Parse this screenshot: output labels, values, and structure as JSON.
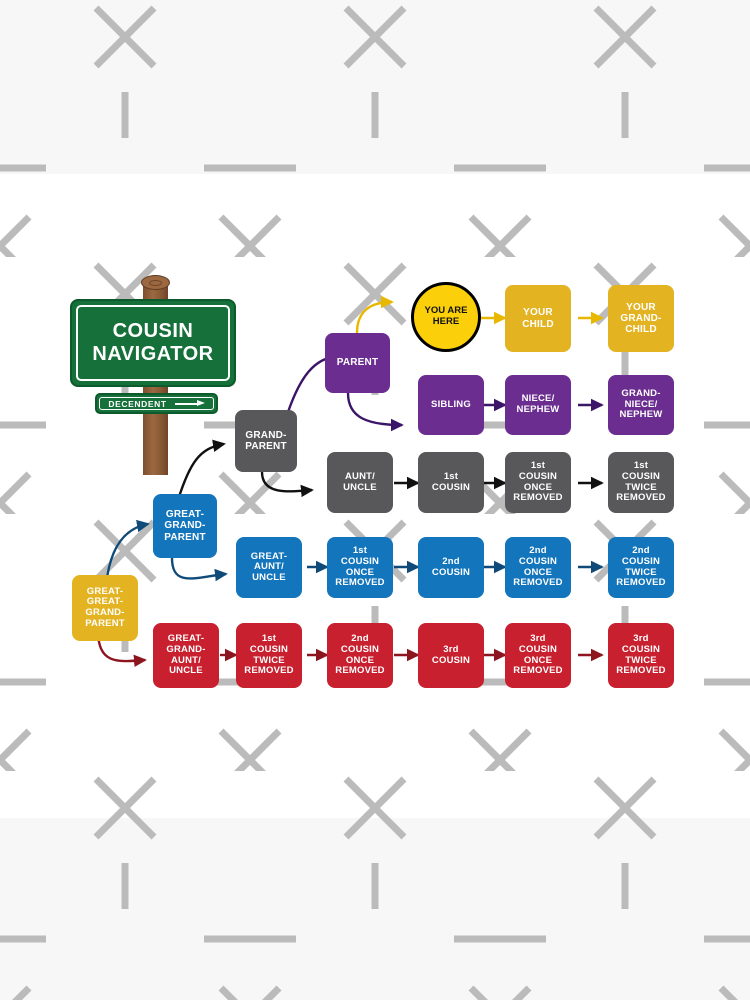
{
  "page": {
    "background_band_color": "#f7f7f7",
    "canvas_color": "#ffffff",
    "watermark_color": "#bbbbbb"
  },
  "signpost": {
    "title_line1": "COUSIN",
    "title_line2": "NAVIGATOR",
    "subsign_label": "DECENDENT",
    "subsign_arrow": "right-arrow",
    "sign_color": "#16703a",
    "post_color": "#8a5a36"
  },
  "colors": {
    "self_yellow": "#fbd00b",
    "descendant_gold": "#e3b322",
    "sibling_purple": "#6b2d90",
    "first_cousin_gray": "#58585a",
    "second_cousin_blue": "#1375bc",
    "third_cousin_red": "#c8202e",
    "ancestor_yellow": "#e3b322"
  },
  "focus": {
    "label_line1": "YOU ARE",
    "label_line2": "HERE"
  },
  "ancestors": [
    {
      "id": "parent",
      "label": "PARENT",
      "color": "purple"
    },
    {
      "id": "grandparent",
      "label": "GRAND-\nPARENT",
      "color": "gray"
    },
    {
      "id": "great-grandparent",
      "label": "GREAT-\nGRAND-\nPARENT",
      "color": "blue"
    },
    {
      "id": "great-great-grandparent",
      "label": "GREAT-\nGREAT-\nGRAND-\nPARENT",
      "color": "gold"
    }
  ],
  "rows": [
    {
      "id": "descendants",
      "color": "gold",
      "cells": [
        {
          "label": "YOUR\nCHILD"
        },
        {
          "label": "YOUR\nGRAND-\nCHILD"
        }
      ]
    },
    {
      "id": "siblings",
      "color": "purple",
      "cells": [
        {
          "label": "SIBLING"
        },
        {
          "label": "NIECE/\nNEPHEW"
        },
        {
          "label": "GRAND-\nNIECE/\nNEPHEW"
        }
      ]
    },
    {
      "id": "first-cousins",
      "color": "gray",
      "cells": [
        {
          "label": "AUNT/\nUNCLE"
        },
        {
          "label": "1st\nCOUSIN"
        },
        {
          "label": "1st\nCOUSIN\nONCE\nREMOVED"
        },
        {
          "label": "1st\nCOUSIN\nTWICE\nREMOVED"
        }
      ]
    },
    {
      "id": "second-cousins",
      "color": "blue",
      "cells": [
        {
          "label": "GREAT-\nAUNT/\nUNCLE"
        },
        {
          "label": "1st\nCOUSIN\nONCE\nREMOVED"
        },
        {
          "label": "2nd\nCOUSIN"
        },
        {
          "label": "2nd\nCOUSIN\nONCE\nREMOVED"
        },
        {
          "label": "2nd\nCOUSIN\nTWICE\nREMOVED"
        }
      ]
    },
    {
      "id": "third-cousins",
      "color": "red",
      "cells": [
        {
          "label": "GREAT-\nGRAND-\nAUNT/\nUNCLE"
        },
        {
          "label": "1st\nCOUSIN\nTWICE\nREMOVED"
        },
        {
          "label": "2nd\nCOUSIN\nONCE\nREMOVED"
        },
        {
          "label": "3rd\nCOUSIN"
        },
        {
          "label": "3rd\nCOUSIN\nONCE\nREMOVED"
        },
        {
          "label": "3rd\nCOUSIN\nTWICE\nREMOVED"
        }
      ]
    }
  ]
}
